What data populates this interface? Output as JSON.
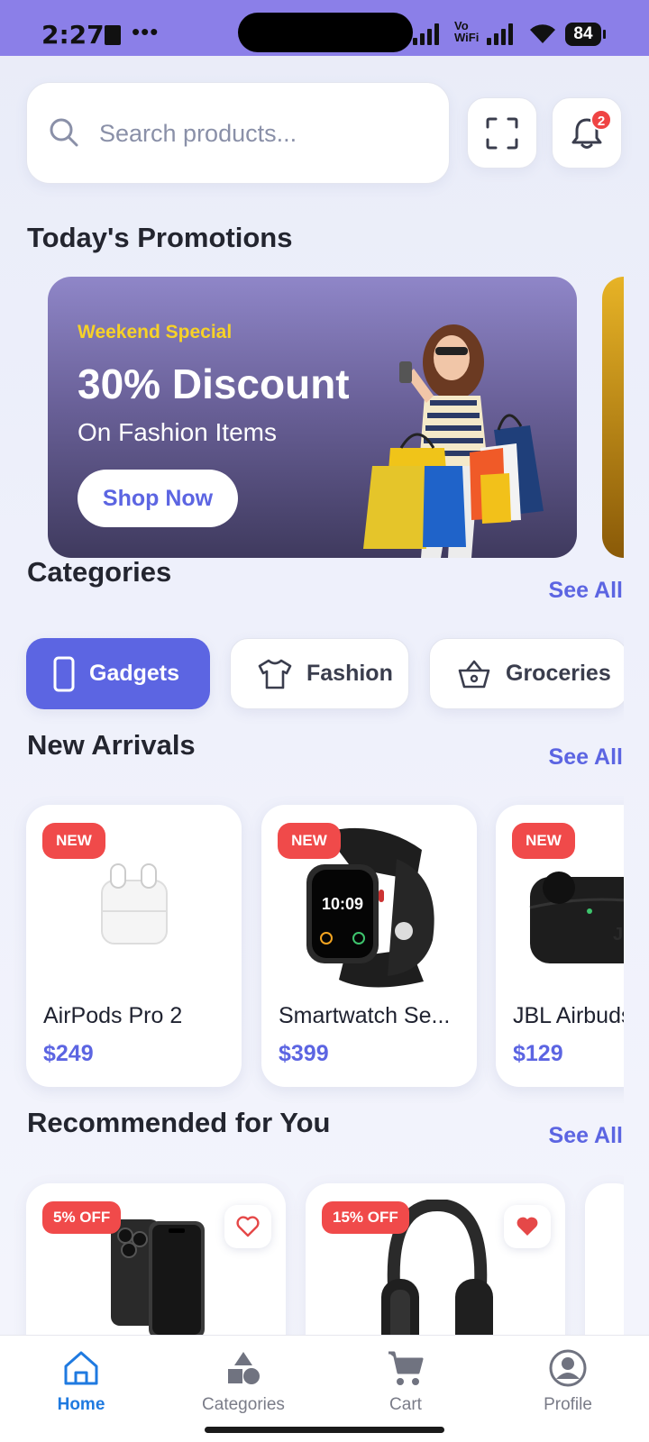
{
  "status_bar": {
    "time": "2:27",
    "dots": "•••",
    "network_label_top": "Vo",
    "network_label_bottom": "WiFi",
    "battery": "84"
  },
  "search": {
    "placeholder": "Search products...",
    "notification_count": "2"
  },
  "promotions": {
    "section_title": "Today's Promotions",
    "banner": {
      "tag": "Weekend Special",
      "title": "30% Discount",
      "subtitle": "On Fashion Items",
      "button_label": "Shop Now"
    }
  },
  "categories": {
    "section_title": "Categories",
    "see_all": "See All",
    "items": [
      {
        "label": "Gadgets",
        "icon": "phone-icon",
        "active": true
      },
      {
        "label": "Fashion",
        "icon": "tshirt-icon",
        "active": false
      },
      {
        "label": "Groceries",
        "icon": "basket-icon",
        "active": false
      }
    ]
  },
  "new_arrivals": {
    "section_title": "New Arrivals",
    "see_all": "See All",
    "badge": "NEW",
    "products": [
      {
        "name": "AirPods Pro 2",
        "price": "$249"
      },
      {
        "name": "Smartwatch Se...",
        "price": "$399"
      },
      {
        "name": "JBL Airbuds",
        "price": "$129"
      }
    ]
  },
  "recommended": {
    "section_title": "Recommended for You",
    "see_all": "See All",
    "products": [
      {
        "discount": "5% OFF",
        "favorited": false
      },
      {
        "discount": "15% OFF",
        "favorited": true
      }
    ]
  },
  "bottom_nav": {
    "items": [
      {
        "label": "Home",
        "active": true
      },
      {
        "label": "Categories",
        "active": false
      },
      {
        "label": "Cart",
        "active": false
      },
      {
        "label": "Profile",
        "active": false
      }
    ]
  },
  "colors": {
    "accent": "#5c65e2",
    "status_bar": "#8b7fe8",
    "badge_red": "#f04a4a",
    "promo_tag": "#f7d227",
    "nav_active": "#1f7ae0"
  }
}
